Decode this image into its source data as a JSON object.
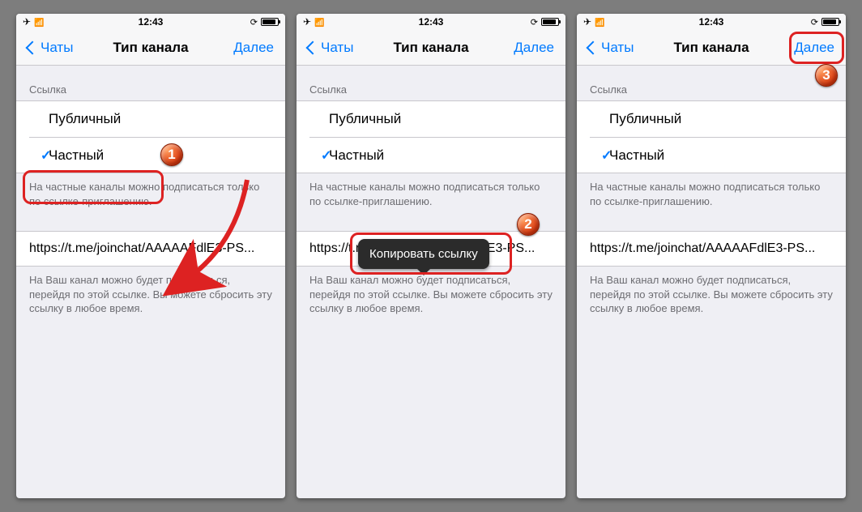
{
  "statusbar": {
    "time": "12:43"
  },
  "navbar": {
    "back_label": "Чаты",
    "title": "Тип канала",
    "next_label": "Далее"
  },
  "section": {
    "link_header": "Ссылка"
  },
  "options": {
    "public": "Публичный",
    "private": "Частный"
  },
  "hint": {
    "private_info": "На частные каналы можно подписаться только по ссылке-приглашению."
  },
  "link": {
    "value": "https://t.me/joinchat/AAAAAFdlE3-PS..."
  },
  "link_hint": "На Ваш канал можно будет подписаться, перейдя по этой ссылке. Вы можете сбросить эту ссылку в любое время.",
  "tooltip": {
    "copy": "Копировать ссылку"
  },
  "badges": {
    "one": "1",
    "two": "2",
    "three": "3"
  }
}
